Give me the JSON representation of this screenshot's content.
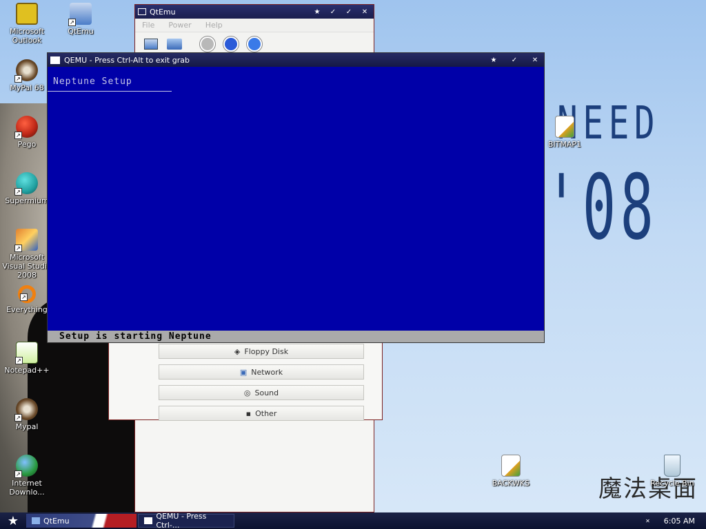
{
  "desktop": {
    "icons": [
      {
        "label": "Microsoft Outlook",
        "color": "#e0c020"
      },
      {
        "label": "QtEmu",
        "color": "#4a7cc8"
      },
      {
        "label": "MyPal 68",
        "color": "#6a4a2a"
      },
      {
        "label": "Pego",
        "color": "#c02818"
      },
      {
        "label": "Supermium",
        "color": "#20a0a0"
      },
      {
        "label": "Microsoft Visual Studio 2008",
        "color": "#e08030"
      },
      {
        "label": "Everything",
        "color": "#f08010"
      },
      {
        "label": "Notepad++",
        "color": "#80c040"
      },
      {
        "label": "Mypal",
        "color": "#6a4a2a"
      },
      {
        "label": "Internet Downlo...",
        "color": "#2a9a40"
      },
      {
        "label": "BITMAP1",
        "color": "#f0f0f0"
      },
      {
        "label": "BACKWKS",
        "color": "#f0f0f0"
      },
      {
        "label": "Recycle Bin",
        "color": "#d8e8f0"
      }
    ],
    "wallpaper": {
      "line1": "NEED",
      "line2": "'08",
      "kanji": "魔法桌面"
    }
  },
  "qtemu_window": {
    "title": "QtEmu",
    "menu": [
      "File",
      "Power",
      "Help"
    ],
    "buttons": [
      "Floppy Disk",
      "Network",
      "Sound",
      "Other"
    ]
  },
  "qemu_window": {
    "title": "QEMU - Press Ctrl-Alt to exit grab",
    "heading": "Neptune Setup",
    "status": "Setup is starting Neptune"
  },
  "taskbar": {
    "items": [
      "QtEmu",
      "QEMU - Press Ctrl-..."
    ],
    "clock": "6:05 AM"
  }
}
